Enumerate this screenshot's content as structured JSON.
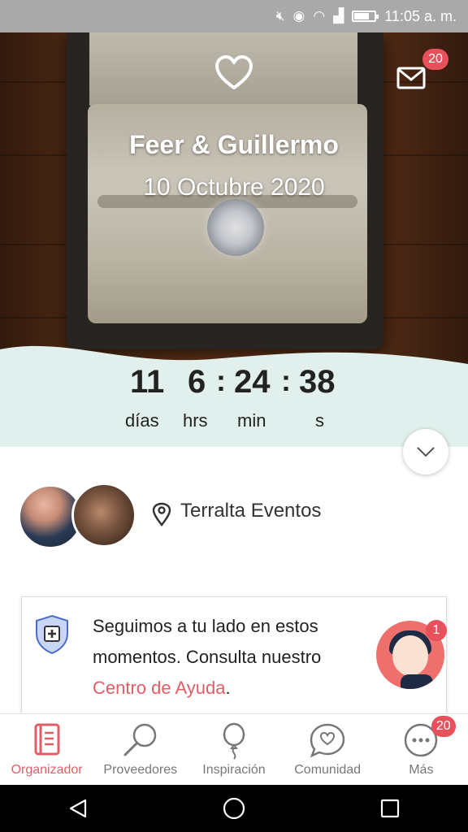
{
  "status_bar": {
    "time": "11:05 a. m."
  },
  "header": {
    "couple_names": "Feer & Guillermo",
    "wedding_date": "10 Octubre 2020",
    "messages_badge": "20"
  },
  "countdown": {
    "days": "11",
    "days_label": "días",
    "hours": "6",
    "hours_label": "hrs",
    "minutes": "24",
    "minutes_label": "min",
    "seconds": "38",
    "seconds_label": "s",
    "separator": ":"
  },
  "venue": {
    "name": "Terralta Eventos"
  },
  "help_card": {
    "text": "Seguimos a tu lado en estos momentos. Consulta nuestro ",
    "link": "Centro de Ayuda",
    "suffix": ".",
    "assistant_badge": "1"
  },
  "bottom_nav": {
    "items": [
      {
        "label": "Organizador",
        "icon": "planner-icon"
      },
      {
        "label": "Proveedores",
        "icon": "magnifier-icon"
      },
      {
        "label": "Inspiración",
        "icon": "balloon-icon"
      },
      {
        "label": "Comunidad",
        "icon": "chat-heart-icon"
      },
      {
        "label": "Más",
        "icon": "more-dots-icon",
        "badge": "20"
      }
    ]
  },
  "colors": {
    "accent": "#e35d66",
    "countdown_bg": "#e1f0ec",
    "badge": "#e8505b"
  }
}
